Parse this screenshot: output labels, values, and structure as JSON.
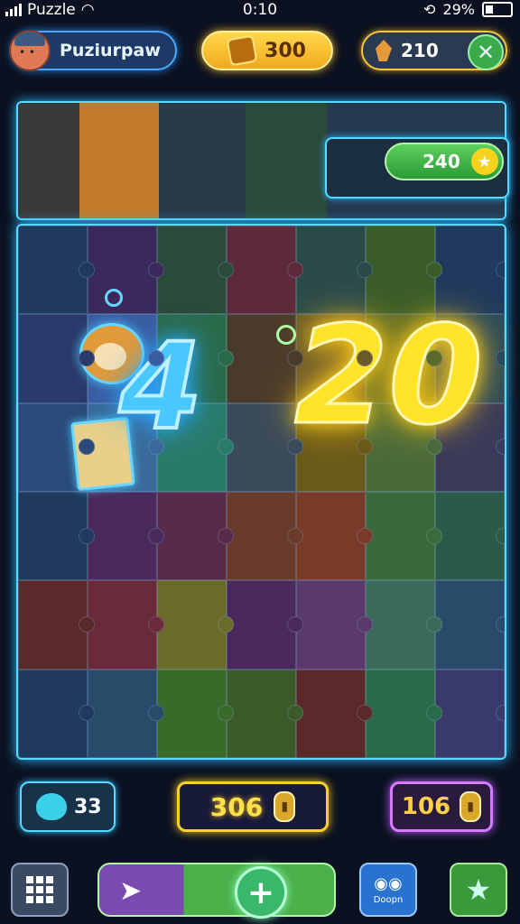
{
  "status_bar": {
    "carrier": "Puzzle",
    "time": "0:10",
    "battery_percent": "29%"
  },
  "hud": {
    "player_name": "Puziurpaw",
    "coins": "300",
    "gems": "210",
    "close_icon": "close-icon"
  },
  "preview": {
    "score": "240",
    "star_icon": "star-icon"
  },
  "board": {
    "number_left": "4",
    "number_right": "20",
    "tile_colors": [
      [
        "#1f3a5c",
        "#3a2a5c",
        "#2a4a3a",
        "#5c2a3a",
        "#2a4a4a",
        "#3a5c2a",
        "#1f3a5c"
      ],
      [
        "#2a3a6a",
        "#3a5ca0",
        "#2a6a4a",
        "#4a3a2a",
        "#6a5a2a",
        "#5a6a2a",
        "#2a4a5a"
      ],
      [
        "#2a4a7a",
        "#3a6a9a",
        "#2a7a6a",
        "#3a4a5a",
        "#6a5a1a",
        "#4a6a3a",
        "#3a3a5a"
      ],
      [
        "#1f3a5c",
        "#4a2a5c",
        "#5a2a4a",
        "#6a3a2a",
        "#7a3a2a",
        "#3a6a3a",
        "#2a5a4a"
      ],
      [
        "#5a2a2a",
        "#6a2a3a",
        "#6a6a2a",
        "#4a2a5a",
        "#5a3a6a",
        "#3a6a5a",
        "#2a4a6a"
      ],
      [
        "#1f3a5c",
        "#2a4a6a",
        "#3a6a2a",
        "#3a5a2a",
        "#5a2a2a",
        "#2a6a4a",
        "#3a3a6a"
      ]
    ]
  },
  "counters": {
    "lives": "33",
    "moves": "306",
    "moves_icon": "coin-icon",
    "bonus": "106",
    "bonus_icon": "coin-icon"
  },
  "nav": {
    "menu_icon": "grid-icon",
    "send_icon": "send-icon",
    "add_icon": "plus-icon",
    "shop_label": "Doopn",
    "star_icon": "star-icon"
  }
}
